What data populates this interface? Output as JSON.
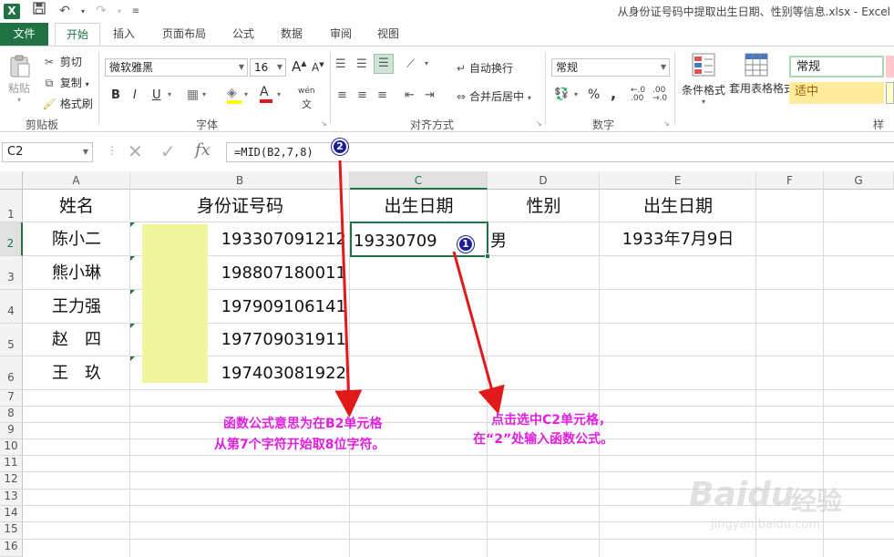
{
  "window": {
    "title": "从身份证号码中提取出生日期、性别等信息.xlsx - Excel",
    "app_icon": "X"
  },
  "ribbon_tabs": [
    "文件",
    "开始",
    "插入",
    "页面布局",
    "公式",
    "数据",
    "审阅",
    "视图"
  ],
  "active_tab": "开始",
  "clipboard": {
    "paste": "粘贴",
    "cut": "剪切",
    "copy": "复制",
    "format_painter": "格式刷",
    "label": "剪贴板"
  },
  "font": {
    "name": "微软雅黑",
    "size": "16",
    "label": "字体",
    "grow": "A",
    "shrink": "A",
    "bold": "B",
    "italic": "I",
    "underline": "U",
    "color_glyph": "A",
    "phonetic": "wén"
  },
  "alignment": {
    "wrap": "自动换行",
    "merge": "合并后居中",
    "label": "对齐方式"
  },
  "number": {
    "format": "常规",
    "label": "数字",
    "percent": "%",
    "comma": ","
  },
  "styles": {
    "conditional": "条件格式",
    "table_format": "套用表格格式",
    "normal": "常规",
    "neutral": "适中",
    "label": "样式"
  },
  "formula_bar": {
    "name_box": "C2",
    "formula": "=MID(B2,7,8)",
    "fx": "fx"
  },
  "columns": [
    "A",
    "B",
    "C",
    "D",
    "E",
    "F",
    "G"
  ],
  "rows": [
    "1",
    "2",
    "3",
    "4",
    "5",
    "6",
    "7",
    "8",
    "9",
    "10",
    "11",
    "12",
    "13",
    "14",
    "15",
    "16"
  ],
  "headers": {
    "A1": "姓名",
    "B1": "身份证号码",
    "C1": "出生日期",
    "D1": "性别",
    "E1": "出生日期"
  },
  "names": [
    "陈小二",
    "熊小琳",
    "王力强",
    "赵　四",
    "王　玖"
  ],
  "ids": [
    "193307091212",
    "198807180011",
    "197909106141",
    "197709031911",
    "197403081922"
  ],
  "C2": "19330709",
  "D2": "男",
  "E2": "1933年7月9日",
  "annotations": {
    "badge1": "1",
    "badge2": "2",
    "note_left_1": "函数公式意思为在B2单元格",
    "note_left_2": "从第7个字符开始取8位字符。",
    "note_right_1": "点击选中C2单元格，",
    "note_right_2": "在“2”处输入函数公式。"
  },
  "watermark": {
    "brand": "Baidu",
    "brand_cn": "经验",
    "url": "jingyan.baidu.com"
  },
  "colors": {
    "excel_green": "#217346",
    "annotation_magenta": "#e020e0",
    "arrow_red": "#e01a1a",
    "badge_blue": "#1b1f9a",
    "id_mask": "#eef59a"
  }
}
